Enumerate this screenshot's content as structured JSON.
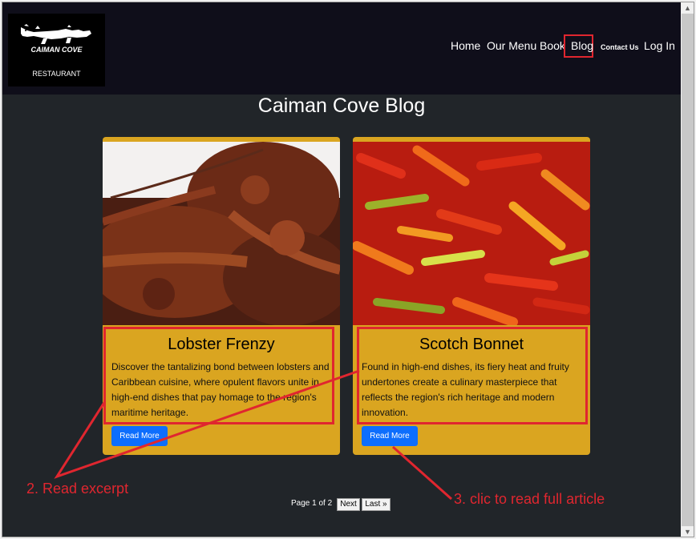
{
  "header": {
    "logo_brand": "CAIMAN COVE",
    "logo_sub": "RESTAURANT",
    "nav": [
      "Home",
      "Our Menu",
      "Book",
      "Blog",
      "Contact Us",
      "Log In"
    ]
  },
  "page_title": "Caiman Cove Blog",
  "posts": [
    {
      "title": "Lobster Frenzy",
      "excerpt": "Discover the tantalizing bond between lobsters and Caribbean cuisine, where opulent flavors unite in high-end dishes that pay homage to the region's maritime heritage.",
      "button": "Read More",
      "image": "lobster-photo"
    },
    {
      "title": "Scotch Bonnet",
      "excerpt": "Found in high-end dishes, its fiery heat and fruity undertones create a culinary masterpiece that reflects the region's rich heritage and modern innovation.",
      "button": "Read More",
      "image": "chili-peppers-photo"
    }
  ],
  "pagination": {
    "page_prefix": "Page",
    "current": "1",
    "of_label": "of",
    "total": "2",
    "next": "Next",
    "last": "Last »"
  },
  "annotations": {
    "step2": "2. Read excerpt",
    "step3": "3. clic to read full article"
  },
  "colors": {
    "accent_red": "#e0262f",
    "card_gold": "#daa520",
    "button_blue": "#0d6efd",
    "page_bg": "#212529",
    "navbar_bg": "#0f0e1a"
  },
  "icons": {
    "logo": "crocodile-icon",
    "scroll_up": "scroll-up-arrow-icon",
    "scroll_down": "scroll-down-arrow-icon"
  }
}
